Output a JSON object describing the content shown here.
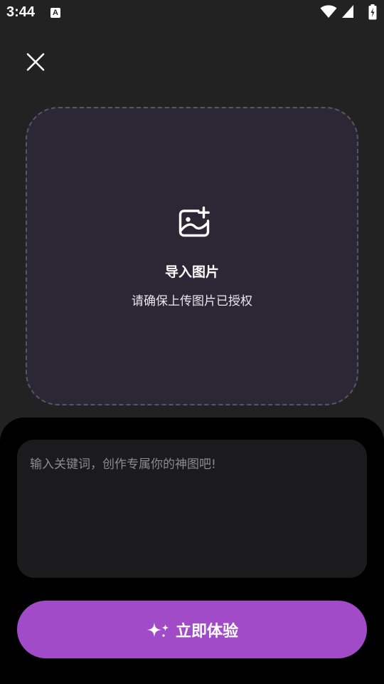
{
  "status_bar": {
    "time": "3:44",
    "notification_glyph": "A"
  },
  "import_area": {
    "title": "导入图片",
    "subtitle": "请确保上传图片已授权"
  },
  "prompt": {
    "placeholder": "输入关键词，创作专属你的神图吧!"
  },
  "cta": {
    "label": "立即体验"
  },
  "colors": {
    "background": "#222222",
    "import_area_bg": "#2c2735",
    "panel_bg": "#000000",
    "prompt_bg": "#1b1b1d",
    "accent": "#a24bc8"
  },
  "icons": [
    "close-icon",
    "image-add-icon",
    "sparkle-icon",
    "wifi-icon",
    "cellular-signal-icon",
    "battery-icon"
  ]
}
